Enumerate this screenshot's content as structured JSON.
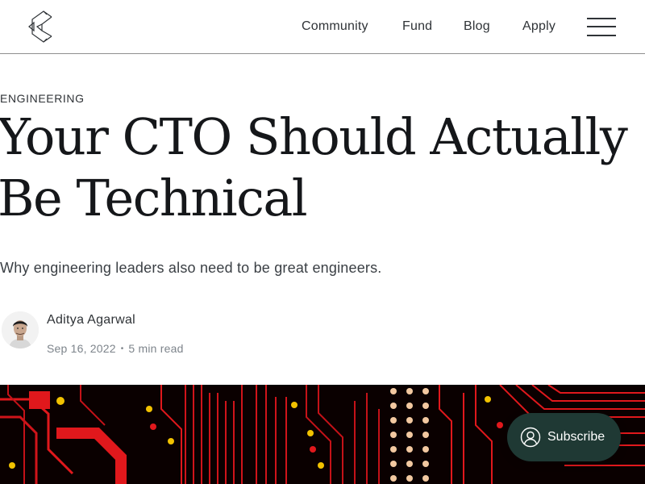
{
  "nav": {
    "logo_icon": "brand-c-logo-icon",
    "links": [
      "Community",
      "Fund",
      "Blog",
      "Apply"
    ],
    "menu_icon": "hamburger-menu-icon"
  },
  "article": {
    "tag": "ENGINEERING",
    "title": "Your CTO Should Actually Be Technical",
    "subtitle": "Why engineering leaders also need to be great engineers.",
    "author": "Aditya Agarwal",
    "date": "Sep 16, 2022",
    "reading_time": "5 min read",
    "hero_image": "red-circuit-board-image"
  },
  "subscribe": {
    "label": "Subscribe",
    "icon": "user-circle-icon"
  },
  "colors": {
    "text": "#15171a",
    "muted": "#7d848b",
    "divider": "#8f8f8f",
    "subscribe_bg": "#1f3934",
    "hero_red": "#e0181c"
  }
}
